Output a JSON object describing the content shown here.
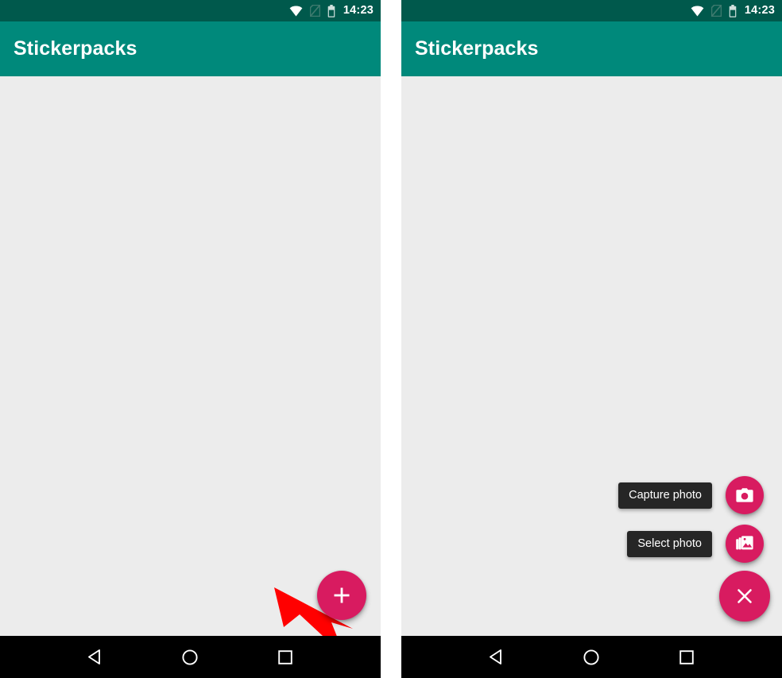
{
  "status_bar": {
    "time": "14:23",
    "icons": [
      "wifi-icon",
      "no-sim-icon",
      "battery-icon"
    ]
  },
  "app_bar": {
    "title": "Stickerpacks"
  },
  "panels": {
    "left": {
      "name": "closed-fab-screen",
      "fab": {
        "icon": "plus-icon",
        "label": "Add stickerpack"
      },
      "annotation": {
        "type": "arrow",
        "color": "#FF0000",
        "points_to": "add-fab"
      }
    },
    "right": {
      "name": "expanded-fab-menu-screen",
      "menu_items": [
        {
          "label": "Capture photo",
          "icon": "camera-icon"
        },
        {
          "label": "Select photo",
          "icon": "gallery-icon"
        }
      ],
      "close_fab": {
        "icon": "close-icon",
        "label": "Close menu"
      }
    }
  },
  "nav_bar": {
    "buttons": [
      {
        "name": "back",
        "icon": "back-triangle-icon"
      },
      {
        "name": "home",
        "icon": "home-circle-icon"
      },
      {
        "name": "recents",
        "icon": "recents-square-icon"
      }
    ]
  },
  "colors": {
    "status_bar": "#00594C",
    "app_bar": "#00897B",
    "content_bg": "#ECECEC",
    "fab": "#D81B60",
    "label_bg": "#262626",
    "nav_bar": "#000000",
    "annotation": "#FF0000"
  }
}
